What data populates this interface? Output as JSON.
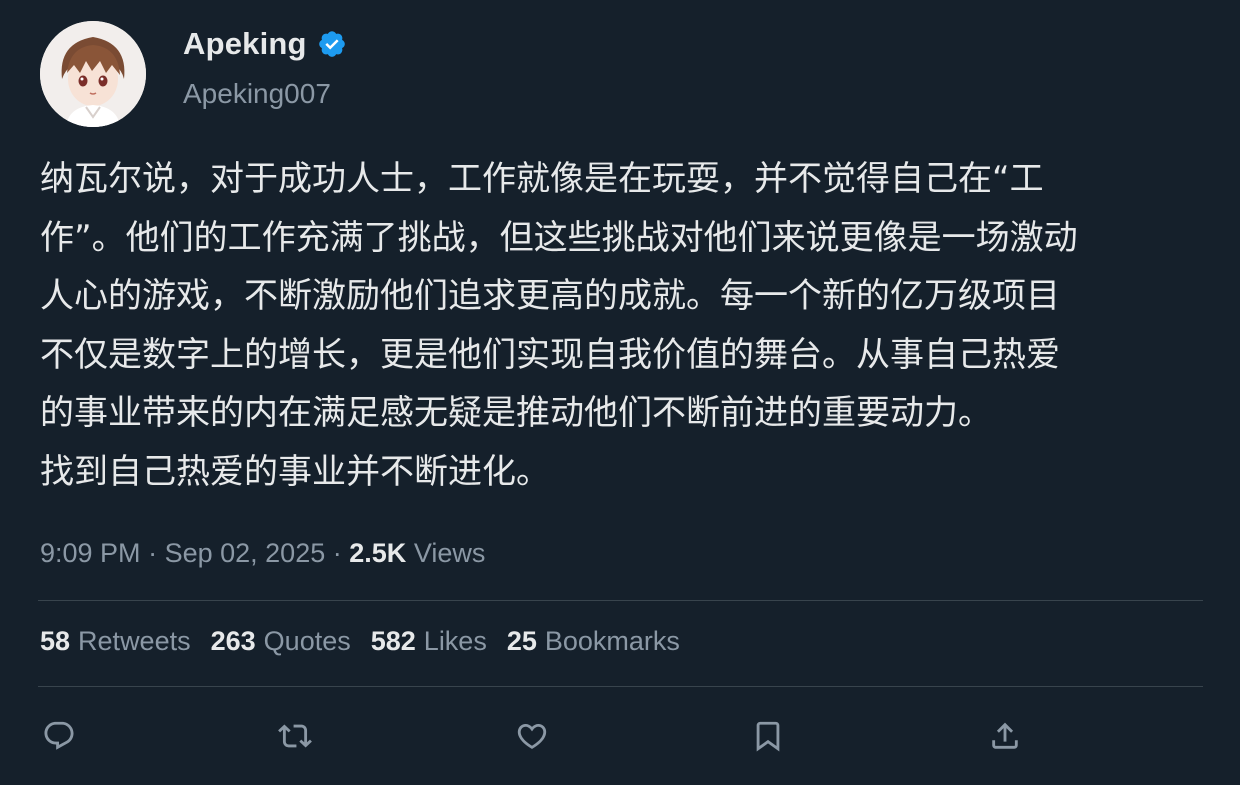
{
  "author": {
    "display_name": "Apeking",
    "handle": "Apeking007",
    "verified": true
  },
  "tweet": {
    "lines": [
      "纳瓦尔说，对于成功人士，工作就像是在玩耍，并不觉得自己在“工",
      "作”。他们的工作充满了挑战，但这些挑战对他们来说更像是一场激动",
      "人心的游戏，不断激励他们追求更高的成就。每一个新的亿万级项目",
      "不仅是数字上的增长，更是他们实现自我价值的舞台。从事自己热爱",
      "的事业带来的内在满足感无疑是推动他们不断前进的重要动力。",
      "找到自己热爱的事业并不断进化。"
    ],
    "time": "9:09 PM",
    "date": "Sep 02, 2025",
    "views_count": "2.5K",
    "views_label": "Views"
  },
  "stats": [
    {
      "count": "58",
      "label": "Retweets"
    },
    {
      "count": "263",
      "label": "Quotes"
    },
    {
      "count": "582",
      "label": "Likes"
    },
    {
      "count": "25",
      "label": "Bookmarks"
    }
  ],
  "actions": [
    {
      "name": "reply-icon"
    },
    {
      "name": "retweet-icon"
    },
    {
      "name": "like-icon"
    },
    {
      "name": "bookmark-icon"
    },
    {
      "name": "share-icon"
    }
  ],
  "colors": {
    "background": "#15202b",
    "text_primary": "#e7e9ea",
    "text_secondary": "#8b98a5",
    "divider": "#38444d",
    "verified_badge": "#1d9bf0"
  }
}
